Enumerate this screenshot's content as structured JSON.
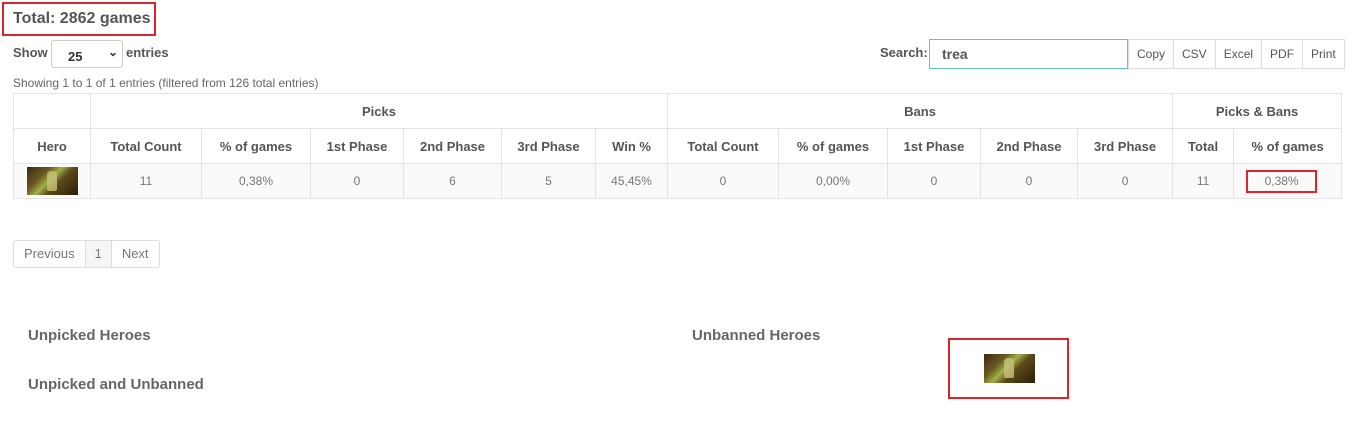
{
  "total": {
    "text": "Total: 2862 games"
  },
  "length_control": {
    "show_label": "Show",
    "selected": "25",
    "entries_label": "entries"
  },
  "search": {
    "label": "Search:",
    "value": "trea"
  },
  "export_buttons": [
    "Copy",
    "CSV",
    "Excel",
    "PDF",
    "Print"
  ],
  "info_text": "Showing 1 to 1 of 1 entries (filtered from 126 total entries)",
  "table": {
    "groups": [
      "Picks",
      "Bans",
      "Picks & Bans"
    ],
    "columns": [
      "Hero",
      "Total Count",
      "% of games",
      "1st Phase",
      "2nd Phase",
      "3rd Phase",
      "Win %",
      "Total Count",
      "% of games",
      "1st Phase",
      "2nd Phase",
      "3rd Phase",
      "Total",
      "% of games"
    ],
    "row": {
      "hero_icon": "hero-portrait-icon",
      "cells": [
        "11",
        "0,38%",
        "0",
        "6",
        "5",
        "45,45%",
        "0",
        "0,00%",
        "0",
        "0",
        "0",
        "11",
        "0,38%"
      ]
    }
  },
  "pagination": {
    "previous": "Previous",
    "page": "1",
    "next": "Next"
  },
  "sections": {
    "unpicked": "Unpicked Heroes",
    "unpicked_unbanned": "Unpicked and Unbanned",
    "unbanned": "Unbanned Heroes",
    "unbanned_hero_icon": "hero-portrait-icon"
  },
  "colors": {
    "highlight": "#d9252b",
    "search_border": "#5fc5c5"
  }
}
